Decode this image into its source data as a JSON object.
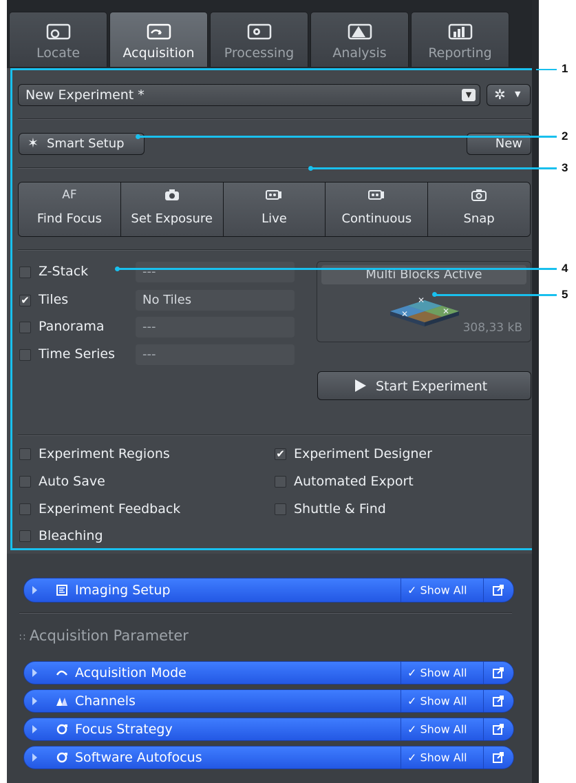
{
  "tabs": [
    {
      "label": "Locate",
      "icon": "locate-icon",
      "active": false
    },
    {
      "label": "Acquisition",
      "icon": "acquisition-icon",
      "active": true
    },
    {
      "label": "Processing",
      "icon": "processing-icon",
      "active": false
    },
    {
      "label": "Analysis",
      "icon": "analysis-icon",
      "active": false
    },
    {
      "label": "Reporting",
      "icon": "reporting-icon",
      "active": false
    }
  ],
  "experiment": {
    "selected": "New Experiment *"
  },
  "smart_setup": {
    "label": "Smart Setup",
    "new_label": "New"
  },
  "actions": [
    {
      "top": "AF",
      "label": "Find Focus",
      "icon": "af-icon"
    },
    {
      "top": "",
      "label": "Set Exposure",
      "icon": "camera-icon"
    },
    {
      "top": "",
      "label": "Live",
      "icon": "live-camera-icon"
    },
    {
      "top": "",
      "label": "Continuous",
      "icon": "continuous-camera-icon"
    },
    {
      "top": "",
      "label": "Snap",
      "icon": "snap-camera-icon"
    }
  ],
  "dimensions": [
    {
      "label": "Z-Stack",
      "checked": false,
      "value": "---"
    },
    {
      "label": "Tiles",
      "checked": true,
      "value": "No Tiles"
    },
    {
      "label": "Panorama",
      "checked": false,
      "value": "---"
    },
    {
      "label": "Time Series",
      "checked": false,
      "value": "---"
    }
  ],
  "blocks": {
    "title": "Multi Blocks Active",
    "size": "308,33 kB"
  },
  "start": {
    "label": "Start Experiment"
  },
  "options_left": [
    {
      "label": "Experiment Regions",
      "checked": false
    },
    {
      "label": "Auto Save",
      "checked": false
    },
    {
      "label": "Experiment Feedback",
      "checked": false
    },
    {
      "label": "Bleaching",
      "checked": false
    }
  ],
  "options_right": [
    {
      "label": "Experiment Designer",
      "checked": true
    },
    {
      "label": "Automated Export",
      "checked": false
    },
    {
      "label": "Shuttle & Find",
      "checked": false
    }
  ],
  "imaging_setup": {
    "label": "Imaging Setup",
    "show_all": "Show All"
  },
  "acq_param_heading": "Acquisition Parameter",
  "param_bars": [
    {
      "label": "Acquisition Mode",
      "show_all": "Show All",
      "icon": "acquisition-mode-icon"
    },
    {
      "label": "Channels",
      "show_all": "Show All",
      "icon": "channels-icon"
    },
    {
      "label": "Focus Strategy",
      "show_all": "Show All",
      "icon": "focus-strategy-icon"
    },
    {
      "label": "Software Autofocus",
      "show_all": "Show All",
      "icon": "software-autofocus-icon"
    }
  ],
  "callouts": [
    "1",
    "2",
    "3",
    "4",
    "5"
  ],
  "colors": {
    "accent_blue": "#2f6bf5",
    "highlight": "#19c0ee",
    "panel": "#43474c"
  }
}
